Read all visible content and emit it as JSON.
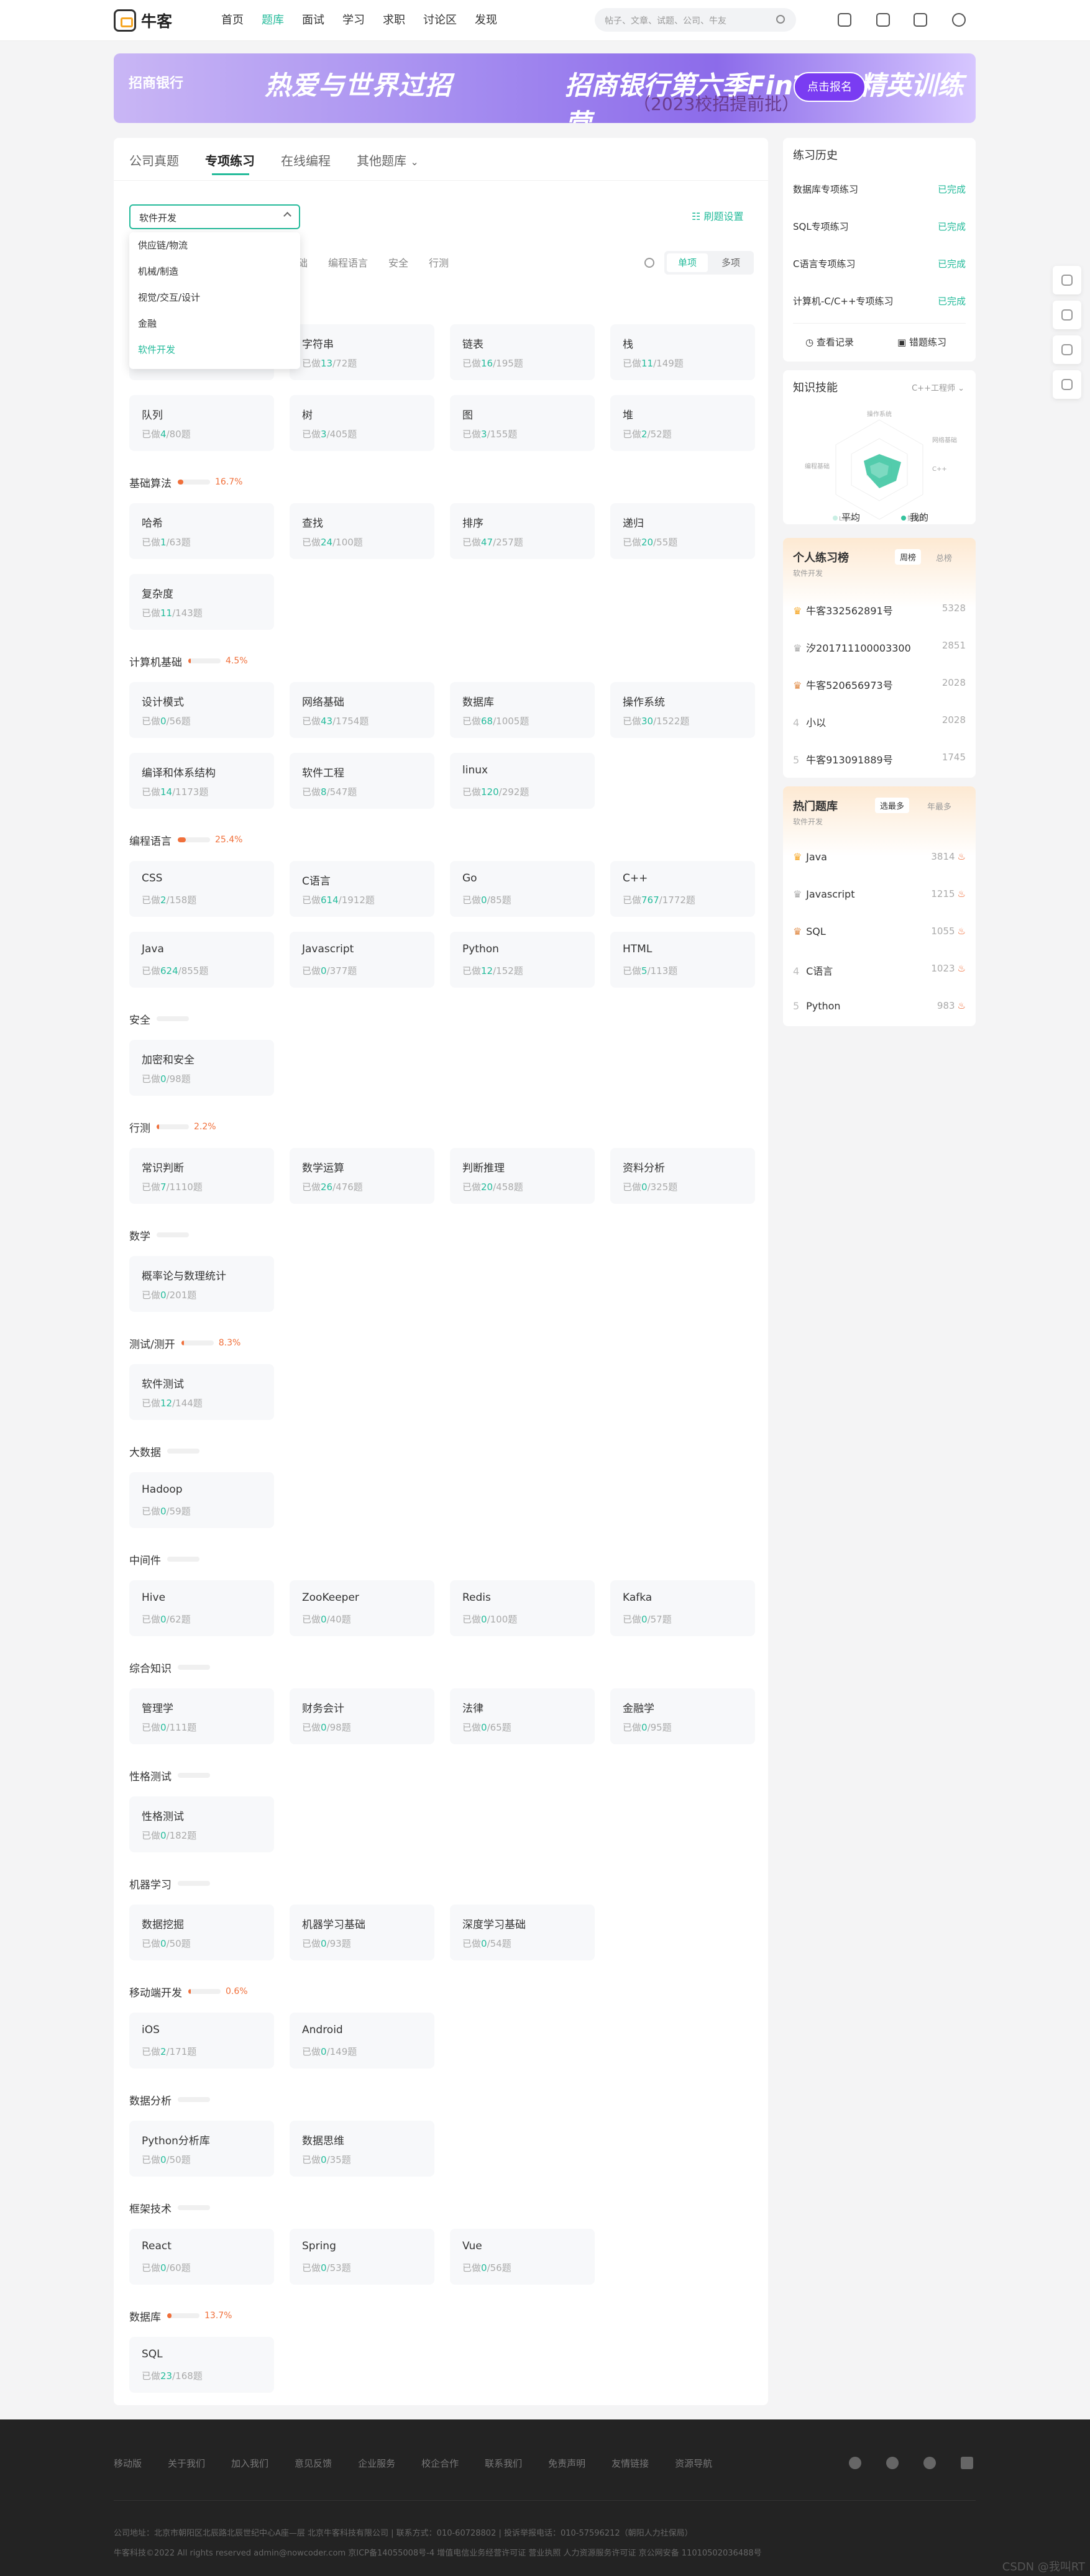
{
  "header": {
    "logo_text": "牛客",
    "nav": [
      "首页",
      "题库",
      "面试",
      "学习",
      "求职",
      "讨论区",
      "发现"
    ],
    "active_nav": "题库",
    "search_placeholder": "帖子、文章、试题、公司、牛友"
  },
  "banner": {
    "brand": "招商银行",
    "title1": "热爱与世界过招",
    "title2": "招商银行第六季FinTech精英训练营",
    "subtitle": "（2023校招提前批）",
    "button": "点击报名"
  },
  "tabs": [
    "公司真题",
    "专项练习",
    "在线编程",
    "其他题库"
  ],
  "active_tab": "专项练习",
  "select": {
    "value": "软件开发",
    "options": [
      "供应链/物流",
      "机械/制造",
      "视觉/交互/设计",
      "金融",
      "软件开发"
    ]
  },
  "brush_settings": "刷题设置",
  "filters": [
    "基础",
    "编程语言",
    "安全",
    "行测"
  ],
  "mode": {
    "single": "单项",
    "multi": "多项"
  },
  "sections": [
    {
      "title": "",
      "pct": "",
      "cards": [
        {
          "name": "",
          "done": "",
          "total": ""
        },
        {
          "name": "字符串",
          "done": "13",
          "total": "/72题"
        },
        {
          "name": "链表",
          "done": "16",
          "total": "/195题"
        },
        {
          "name": "栈",
          "done": "11",
          "total": "/149题"
        },
        {
          "name": "队列",
          "done": "4",
          "total": "/80题"
        },
        {
          "name": "树",
          "done": "3",
          "total": "/405题"
        },
        {
          "name": "图",
          "done": "3",
          "total": "/155题"
        },
        {
          "name": "堆",
          "done": "2",
          "total": "/52题"
        }
      ]
    },
    {
      "title": "基础算法",
      "pct": "16.7%",
      "fill": 0.167,
      "cards": [
        {
          "name": "哈希",
          "done": "1",
          "total": "/63题"
        },
        {
          "name": "查找",
          "done": "24",
          "total": "/100题"
        },
        {
          "name": "排序",
          "done": "47",
          "total": "/257题"
        },
        {
          "name": "递归",
          "done": "20",
          "total": "/55题"
        },
        {
          "name": "复杂度",
          "done": "11",
          "total": "/143题"
        }
      ]
    },
    {
      "title": "计算机基础",
      "pct": "4.5%",
      "fill": 0.045,
      "cards": [
        {
          "name": "设计模式",
          "done": "0",
          "total": "/56题"
        },
        {
          "name": "网络基础",
          "done": "43",
          "total": "/1754题"
        },
        {
          "name": "数据库",
          "done": "68",
          "total": "/1005题"
        },
        {
          "name": "操作系统",
          "done": "30",
          "total": "/1522题"
        },
        {
          "name": "编译和体系结构",
          "done": "14",
          "total": "/1173题"
        },
        {
          "name": "软件工程",
          "done": "8",
          "total": "/547题"
        },
        {
          "name": "linux",
          "done": "120",
          "total": "/292题"
        }
      ]
    },
    {
      "title": "编程语言",
      "pct": "25.4%",
      "fill": 0.254,
      "cards": [
        {
          "name": "CSS",
          "done": "2",
          "total": "/158题"
        },
        {
          "name": "C语言",
          "done": "614",
          "total": "/1912题"
        },
        {
          "name": "Go",
          "done": "0",
          "total": "/85题"
        },
        {
          "name": "C++",
          "done": "767",
          "total": "/1772题"
        },
        {
          "name": "Java",
          "done": "624",
          "total": "/855题"
        },
        {
          "name": "Javascript",
          "done": "0",
          "total": "/377题"
        },
        {
          "name": "Python",
          "done": "12",
          "total": "/152题"
        },
        {
          "name": "HTML",
          "done": "5",
          "total": "/113题"
        }
      ]
    },
    {
      "title": "安全",
      "pct": "",
      "fill": 0,
      "cards": [
        {
          "name": "加密和安全",
          "done": "0",
          "total": "/98题"
        }
      ]
    },
    {
      "title": "行测",
      "pct": "2.2%",
      "fill": 0.022,
      "cards": [
        {
          "name": "常识判断",
          "done": "7",
          "total": "/1110题"
        },
        {
          "name": "数学运算",
          "done": "26",
          "total": "/476题"
        },
        {
          "name": "判断推理",
          "done": "20",
          "total": "/458题"
        },
        {
          "name": "资料分析",
          "done": "0",
          "total": "/325题"
        }
      ]
    },
    {
      "title": "数学",
      "pct": "",
      "fill": 0,
      "cards": [
        {
          "name": "概率论与数理统计",
          "done": "0",
          "total": "/201题"
        }
      ]
    },
    {
      "title": "测试/测开",
      "pct": "8.3%",
      "fill": 0.083,
      "cards": [
        {
          "name": "软件测试",
          "done": "12",
          "total": "/144题"
        }
      ]
    },
    {
      "title": "大数据",
      "pct": "",
      "fill": 0,
      "cards": [
        {
          "name": "Hadoop",
          "done": "0",
          "total": "/59题"
        }
      ]
    },
    {
      "title": "中间件",
      "pct": "",
      "fill": 0,
      "cards": [
        {
          "name": "Hive",
          "done": "0",
          "total": "/62题"
        },
        {
          "name": "ZooKeeper",
          "done": "0",
          "total": "/40题"
        },
        {
          "name": "Redis",
          "done": "0",
          "total": "/100题"
        },
        {
          "name": "Kafka",
          "done": "0",
          "total": "/57题"
        }
      ]
    },
    {
      "title": "综合知识",
      "pct": "",
      "fill": 0,
      "cards": [
        {
          "name": "管理学",
          "done": "0",
          "total": "/111题"
        },
        {
          "name": "财务会计",
          "done": "0",
          "total": "/98题"
        },
        {
          "name": "法律",
          "done": "0",
          "total": "/65题"
        },
        {
          "name": "金融学",
          "done": "0",
          "total": "/95题"
        }
      ]
    },
    {
      "title": "性格测试",
      "pct": "",
      "fill": 0,
      "cards": [
        {
          "name": "性格测试",
          "done": "0",
          "total": "/182题"
        }
      ]
    },
    {
      "title": "机器学习",
      "pct": "",
      "fill": 0,
      "cards": [
        {
          "name": "数据挖掘",
          "done": "0",
          "total": "/50题"
        },
        {
          "name": "机器学习基础",
          "done": "0",
          "total": "/93题"
        },
        {
          "name": "深度学习基础",
          "done": "0",
          "total": "/54题"
        }
      ]
    },
    {
      "title": "移动端开发",
      "pct": "0.6%",
      "fill": 0.006,
      "cards": [
        {
          "name": "iOS",
          "done": "2",
          "total": "/171题"
        },
        {
          "name": "Android",
          "done": "0",
          "total": "/149题"
        }
      ]
    },
    {
      "title": "数据分析",
      "pct": "",
      "fill": 0,
      "cards": [
        {
          "name": "Python分析库",
          "done": "0",
          "total": "/50题"
        },
        {
          "name": "数据思维",
          "done": "0",
          "total": "/35题"
        }
      ]
    },
    {
      "title": "框架技术",
      "pct": "",
      "fill": 0,
      "cards": [
        {
          "name": "React",
          "done": "0",
          "total": "/60题"
        },
        {
          "name": "Spring",
          "done": "0",
          "total": "/53题"
        },
        {
          "name": "Vue",
          "done": "0",
          "total": "/56题"
        }
      ]
    },
    {
      "title": "数据库",
      "pct": "13.7%",
      "fill": 0.137,
      "cards": [
        {
          "name": "SQL",
          "done": "23",
          "total": "/168题"
        }
      ]
    }
  ],
  "done_prefix": "已做",
  "history": {
    "title": "练习历史",
    "items": [
      {
        "name": "数据库专项练习",
        "status": "已完成"
      },
      {
        "name": "SQL专项练习",
        "status": "已完成"
      },
      {
        "name": "C语言专项练习",
        "status": "已完成"
      },
      {
        "name": "计算机-C/C++专项练习",
        "status": "已完成"
      }
    ],
    "view_records": "查看记录",
    "wrong_practice": "错题练习"
  },
  "skills": {
    "title": "知识技能",
    "selector": "C++工程师",
    "axes": [
      "操作系统",
      "网络基础",
      "编程基础",
      "C++",
      "Linux",
      "数据库"
    ],
    "legend_avg": "平均",
    "legend_mine": "我的"
  },
  "practice_rank": {
    "title": "个人练习榜",
    "sub": "软件开发",
    "tab_week": "周榜",
    "tab_total": "总榜",
    "rows": [
      {
        "name": "牛客332562891号",
        "score": "5328"
      },
      {
        "name": "汐201711100003300",
        "score": "2851"
      },
      {
        "name": "牛客520656973号",
        "score": "2028"
      },
      {
        "name": "小以",
        "score": "2028"
      },
      {
        "name": "牛客913091889号",
        "score": "1745"
      }
    ]
  },
  "hot_rank": {
    "title": "热门题库",
    "sub": "软件开发",
    "tab_hot": "选最多",
    "tab_year": "年最多",
    "rows": [
      {
        "name": "Java",
        "score": "3814"
      },
      {
        "name": "Javascript",
        "score": "1215"
      },
      {
        "name": "SQL",
        "score": "1055"
      },
      {
        "name": "C语言",
        "score": "1023"
      },
      {
        "name": "Python",
        "score": "983"
      }
    ]
  },
  "footer": {
    "links": [
      "移动版",
      "关于我们",
      "加入我们",
      "意见反馈",
      "企业服务",
      "校企合作",
      "联系我们",
      "免责声明",
      "友情链接",
      "资源导航"
    ],
    "line1": "公司地址：北京市朝阳区北辰路北辰世纪中心A座—层 北京牛客科技有限公司 | 联系方式：010-60728802 | 投诉举报电话：010-57596212（朝阳人力社保局）",
    "line2": "牛客科技©2022 All rights reserved admin@nowcoder.com   京ICP备14055008号-4   增值电信业务经营许可证   营业执照   人力资源服务许可证   京公网安备 11010502036488号"
  },
  "watermark": "CSDN @我叫RT"
}
